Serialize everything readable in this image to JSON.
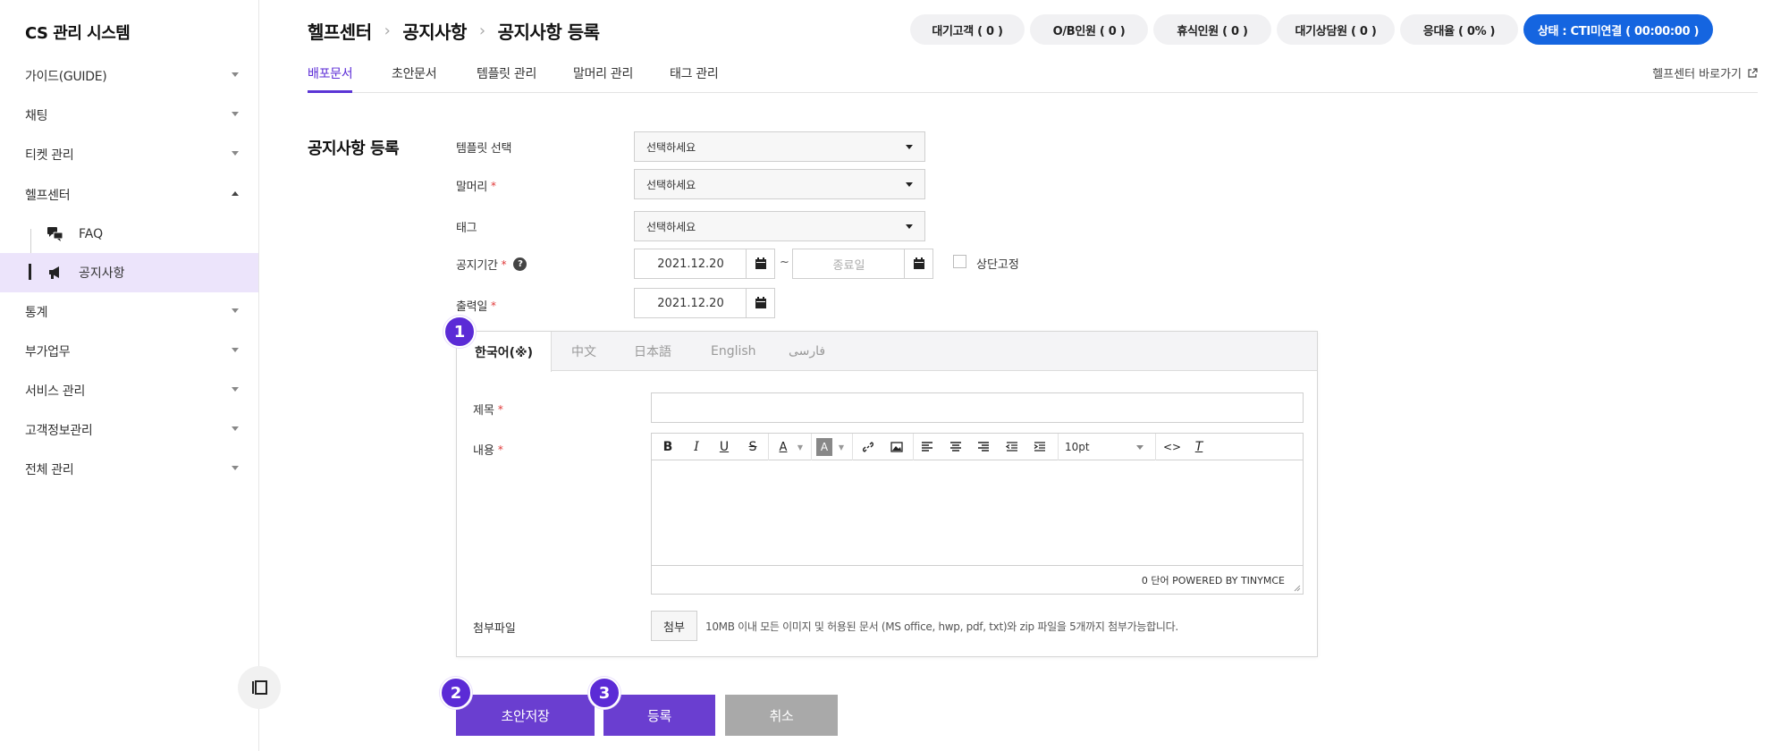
{
  "sidebar": {
    "brand": "CS 관리 시스템",
    "items": [
      {
        "label": "가이드(GUIDE)"
      },
      {
        "label": "채팅"
      },
      {
        "label": "티켓 관리"
      },
      {
        "label": "헬프센터"
      },
      {
        "label": "통계"
      },
      {
        "label": "부가업무"
      },
      {
        "label": "서비스 관리"
      },
      {
        "label": "고객정보관리"
      },
      {
        "label": "전체 관리"
      }
    ],
    "sub_items": [
      {
        "label": "FAQ",
        "icon": "chat-bubbles-icon"
      },
      {
        "label": "공지사항",
        "icon": "megaphone-icon"
      }
    ]
  },
  "header": {
    "breadcrumb": [
      "헬프센터",
      "공지사항",
      "공지사항 등록"
    ],
    "status_pills": [
      "대기고객 ( 0 )",
      "O/B인원 ( 0 )",
      "휴식인원 ( 0 )",
      "대기상담원 ( 0 )",
      "응대율 ( 0% )",
      "상태 : CTI미연결 ( 00:00:00 )"
    ],
    "tabs": [
      "배포문서",
      "초안문서",
      "템플릿 관리",
      "말머리 관리",
      "태그 관리"
    ],
    "help_link": "헬프센터 바로가기"
  },
  "form": {
    "section_title": "공지사항 등록",
    "template_label": "템플릿 선택",
    "template_value": "선택하세요",
    "prefix_label": "말머리",
    "prefix_value": "선택하세요",
    "tag_label": "태그",
    "tag_value": "선택하세요",
    "period_label": "공지기간",
    "start_date": "2021.12.20",
    "end_placeholder": "종료일",
    "tilde": "~",
    "pin_label": "상단고정",
    "print_label": "출력일",
    "print_date": "2021.12.20",
    "required_mark": "*",
    "help_mark": "?"
  },
  "panel": {
    "languages": [
      "한국어(※)",
      "中文",
      "日本語",
      "English",
      "فارسی"
    ],
    "title_label": "제목",
    "content_label": "내용",
    "font_size": "10pt",
    "status_text": "0 단어 POWERED BY TINYMCE",
    "attach_label": "첨부파일",
    "attach_button": "첨부",
    "attach_note": "10MB 이내 모든 이미지 및 허용된 문서 (MS office, hwp, pdf, txt)와 zip 파일을 5개까지 첨부가능합니다."
  },
  "toolbar": {
    "bold": "B",
    "italic": "I",
    "underline": "U",
    "strike": "S",
    "font_color": "A",
    "bg_color": "A",
    "clear_format": "T"
  },
  "actions": {
    "draft_save": "초안저장",
    "register": "등록",
    "cancel": "취소"
  },
  "badges": [
    "1",
    "2",
    "3"
  ],
  "colors": {
    "accent": "#6a3ed0",
    "status_primary": "#1565e0",
    "active_menu_bg": "#ece4fb"
  }
}
